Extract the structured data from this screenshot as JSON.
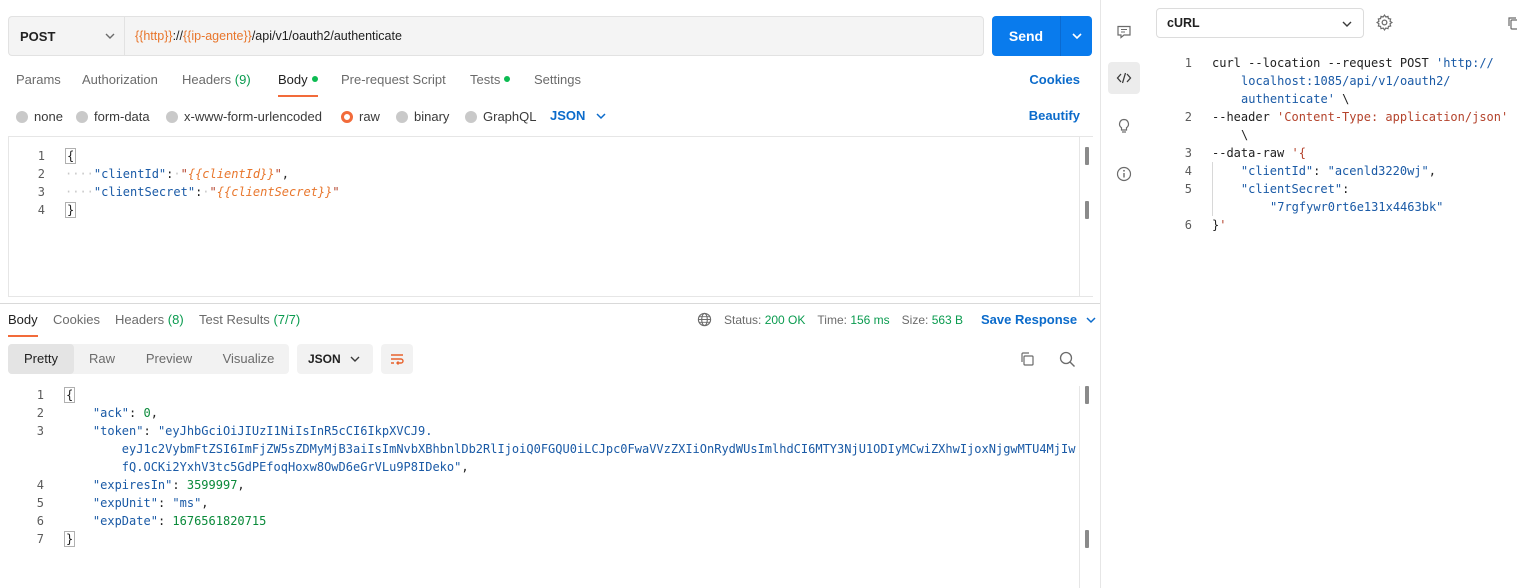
{
  "request": {
    "method": "POST",
    "url_parts": [
      {
        "text": "{{http}}",
        "kind": "var"
      },
      {
        "text": "://",
        "kind": "plain"
      },
      {
        "text": "{{ip-agente}}",
        "kind": "var"
      },
      {
        "text": "/api/v1/oauth2/authenticate",
        "kind": "plain"
      }
    ],
    "send_label": "Send"
  },
  "req_tabs": {
    "params": "Params",
    "authorization": "Authorization",
    "headers": "Headers",
    "headers_count": "(9)",
    "body": "Body",
    "prerequest": "Pre-request Script",
    "tests": "Tests",
    "settings": "Settings",
    "cookies": "Cookies"
  },
  "body_types": {
    "none": "none",
    "form_data": "form-data",
    "urlencoded": "x-www-form-urlencoded",
    "raw": "raw",
    "binary": "binary",
    "graphql": "GraphQL",
    "lang": "JSON",
    "beautify": "Beautify"
  },
  "req_body": {
    "line_numbers": [
      "1",
      "2",
      "3",
      "4"
    ],
    "open": "{",
    "close": "}",
    "k1": "\"clientId\"",
    "v1": "{{clientId}}",
    "k2": "\"clientSecret\"",
    "v2": "{{clientSecret}}"
  },
  "res_tabs": {
    "body": "Body",
    "cookies": "Cookies",
    "headers": "Headers",
    "headers_count": "(8)",
    "tests": "Test Results",
    "tests_count": "(7/7)"
  },
  "res_status": {
    "status_label": "Status:",
    "status_value": "200 OK",
    "time_label": "Time:",
    "time_value": "156 ms",
    "size_label": "Size:",
    "size_value": "563 B",
    "save": "Save Response"
  },
  "res_view": {
    "pretty": "Pretty",
    "raw": "Raw",
    "preview": "Preview",
    "visualize": "Visualize",
    "format": "JSON"
  },
  "res_body": {
    "line_numbers": [
      "1",
      "2",
      "3",
      "4",
      "5",
      "6",
      "7"
    ],
    "open": "{",
    "close": "}",
    "ack_key": "\"ack\"",
    "ack_val": "0",
    "token_key": "\"token\"",
    "token_l1": "\"eyJhbGciOiJIUzI1NiIsInR5cCI6IkpXVCJ9.",
    "token_l2": "eyJ1c2VybmFtZSI6ImFjZW5sZDMyMjB3aiIsImNvbXBhbnlDb2RlIjoiQ0FGQU0iLCJpc0FwaVVzZXIiOnRydWUsImlhdCI6MTY3NjU1ODIyMCwiZXhwIjoxNjgwMTU4MjIw",
    "token_l3": "fQ.OCKi2YxhV3tc5GdPEfoqHoxw8OwD6eGrVLu9P8IDeko\"",
    "expires_key": "\"expiresIn\"",
    "expires_val": "3599997",
    "unit_key": "\"expUnit\"",
    "unit_val": "\"ms\"",
    "date_key": "\"expDate\"",
    "date_val": "1676561820715"
  },
  "snippet": {
    "language": "cURL",
    "line_numbers": [
      "1",
      "2",
      "3",
      "4",
      "5",
      "6"
    ],
    "l1a": "curl --location --request POST ",
    "l1b": "'http://",
    "l1c": "localhost:1085/api/v1/oauth2/",
    "l1d": "authenticate'",
    "l1e": " \\",
    "l2a": "--header ",
    "l2b": "'Content-Type: application/json'",
    "l2c": "\\",
    "l3a": "--data-raw ",
    "l3b": "'{",
    "l4k": "\"clientId\"",
    "l4v": "\"acenld3220wj\"",
    "l5k": "\"clientSecret\"",
    "l5v": "\"7rgfywr0rt6e131x4463bk\"",
    "l6a": "}",
    "l6b": "'"
  }
}
